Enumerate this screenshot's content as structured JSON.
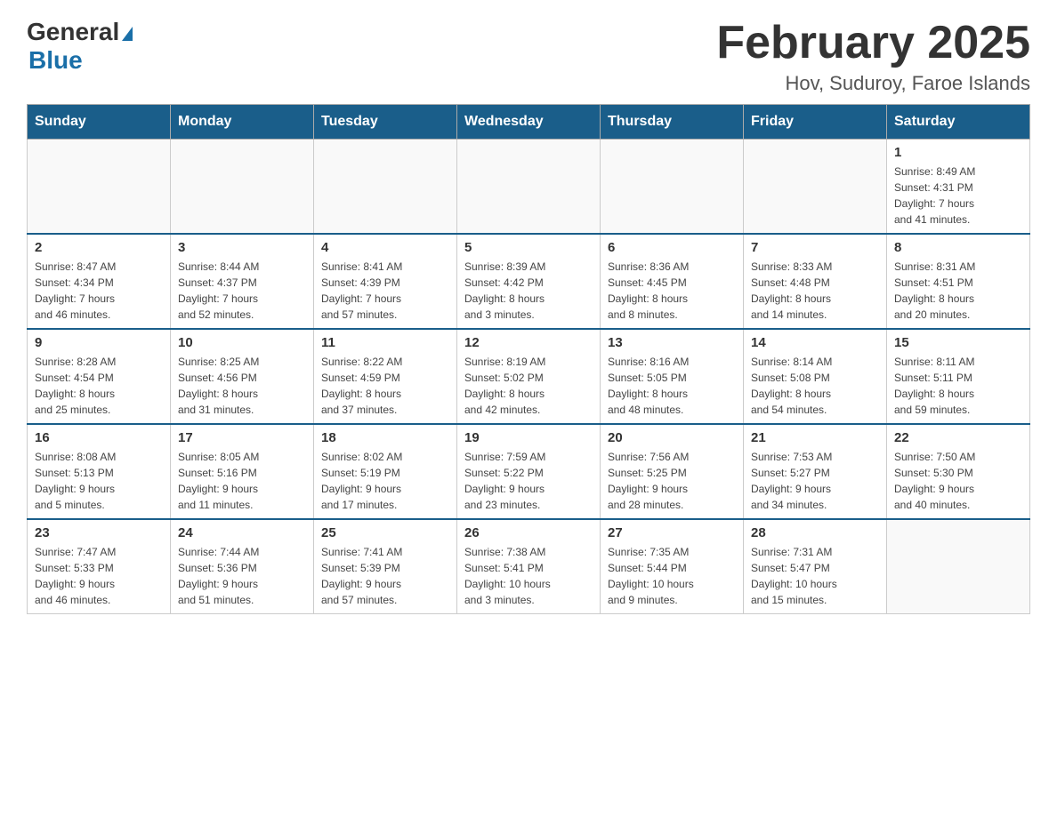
{
  "header": {
    "logo_general": "General",
    "logo_blue": "Blue",
    "title": "February 2025",
    "subtitle": "Hov, Suduroy, Faroe Islands"
  },
  "weekdays": [
    "Sunday",
    "Monday",
    "Tuesday",
    "Wednesday",
    "Thursday",
    "Friday",
    "Saturday"
  ],
  "weeks": [
    [
      {
        "day": "",
        "info": ""
      },
      {
        "day": "",
        "info": ""
      },
      {
        "day": "",
        "info": ""
      },
      {
        "day": "",
        "info": ""
      },
      {
        "day": "",
        "info": ""
      },
      {
        "day": "",
        "info": ""
      },
      {
        "day": "1",
        "info": "Sunrise: 8:49 AM\nSunset: 4:31 PM\nDaylight: 7 hours\nand 41 minutes."
      }
    ],
    [
      {
        "day": "2",
        "info": "Sunrise: 8:47 AM\nSunset: 4:34 PM\nDaylight: 7 hours\nand 46 minutes."
      },
      {
        "day": "3",
        "info": "Sunrise: 8:44 AM\nSunset: 4:37 PM\nDaylight: 7 hours\nand 52 minutes."
      },
      {
        "day": "4",
        "info": "Sunrise: 8:41 AM\nSunset: 4:39 PM\nDaylight: 7 hours\nand 57 minutes."
      },
      {
        "day": "5",
        "info": "Sunrise: 8:39 AM\nSunset: 4:42 PM\nDaylight: 8 hours\nand 3 minutes."
      },
      {
        "day": "6",
        "info": "Sunrise: 8:36 AM\nSunset: 4:45 PM\nDaylight: 8 hours\nand 8 minutes."
      },
      {
        "day": "7",
        "info": "Sunrise: 8:33 AM\nSunset: 4:48 PM\nDaylight: 8 hours\nand 14 minutes."
      },
      {
        "day": "8",
        "info": "Sunrise: 8:31 AM\nSunset: 4:51 PM\nDaylight: 8 hours\nand 20 minutes."
      }
    ],
    [
      {
        "day": "9",
        "info": "Sunrise: 8:28 AM\nSunset: 4:54 PM\nDaylight: 8 hours\nand 25 minutes."
      },
      {
        "day": "10",
        "info": "Sunrise: 8:25 AM\nSunset: 4:56 PM\nDaylight: 8 hours\nand 31 minutes."
      },
      {
        "day": "11",
        "info": "Sunrise: 8:22 AM\nSunset: 4:59 PM\nDaylight: 8 hours\nand 37 minutes."
      },
      {
        "day": "12",
        "info": "Sunrise: 8:19 AM\nSunset: 5:02 PM\nDaylight: 8 hours\nand 42 minutes."
      },
      {
        "day": "13",
        "info": "Sunrise: 8:16 AM\nSunset: 5:05 PM\nDaylight: 8 hours\nand 48 minutes."
      },
      {
        "day": "14",
        "info": "Sunrise: 8:14 AM\nSunset: 5:08 PM\nDaylight: 8 hours\nand 54 minutes."
      },
      {
        "day": "15",
        "info": "Sunrise: 8:11 AM\nSunset: 5:11 PM\nDaylight: 8 hours\nand 59 minutes."
      }
    ],
    [
      {
        "day": "16",
        "info": "Sunrise: 8:08 AM\nSunset: 5:13 PM\nDaylight: 9 hours\nand 5 minutes."
      },
      {
        "day": "17",
        "info": "Sunrise: 8:05 AM\nSunset: 5:16 PM\nDaylight: 9 hours\nand 11 minutes."
      },
      {
        "day": "18",
        "info": "Sunrise: 8:02 AM\nSunset: 5:19 PM\nDaylight: 9 hours\nand 17 minutes."
      },
      {
        "day": "19",
        "info": "Sunrise: 7:59 AM\nSunset: 5:22 PM\nDaylight: 9 hours\nand 23 minutes."
      },
      {
        "day": "20",
        "info": "Sunrise: 7:56 AM\nSunset: 5:25 PM\nDaylight: 9 hours\nand 28 minutes."
      },
      {
        "day": "21",
        "info": "Sunrise: 7:53 AM\nSunset: 5:27 PM\nDaylight: 9 hours\nand 34 minutes."
      },
      {
        "day": "22",
        "info": "Sunrise: 7:50 AM\nSunset: 5:30 PM\nDaylight: 9 hours\nand 40 minutes."
      }
    ],
    [
      {
        "day": "23",
        "info": "Sunrise: 7:47 AM\nSunset: 5:33 PM\nDaylight: 9 hours\nand 46 minutes."
      },
      {
        "day": "24",
        "info": "Sunrise: 7:44 AM\nSunset: 5:36 PM\nDaylight: 9 hours\nand 51 minutes."
      },
      {
        "day": "25",
        "info": "Sunrise: 7:41 AM\nSunset: 5:39 PM\nDaylight: 9 hours\nand 57 minutes."
      },
      {
        "day": "26",
        "info": "Sunrise: 7:38 AM\nSunset: 5:41 PM\nDaylight: 10 hours\nand 3 minutes."
      },
      {
        "day": "27",
        "info": "Sunrise: 7:35 AM\nSunset: 5:44 PM\nDaylight: 10 hours\nand 9 minutes."
      },
      {
        "day": "28",
        "info": "Sunrise: 7:31 AM\nSunset: 5:47 PM\nDaylight: 10 hours\nand 15 minutes."
      },
      {
        "day": "",
        "info": ""
      }
    ]
  ]
}
